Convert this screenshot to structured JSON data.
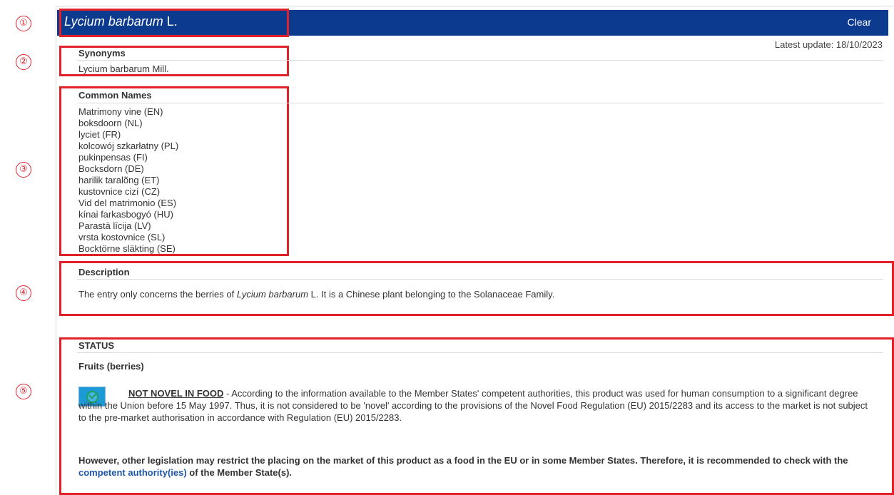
{
  "header": {
    "title_species": "Lycium barbarum",
    "title_author": "L.",
    "clear_label": "Clear"
  },
  "latest_update": "Latest update: 18/10/2023",
  "markers": [
    "①",
    "②",
    "③",
    "④",
    "⑤"
  ],
  "synonyms": {
    "heading": "Synonyms",
    "value": "Lycium barbarum Mill."
  },
  "common_names": {
    "heading": "Common Names",
    "items": [
      "Matrimony vine (EN)",
      "boksdoorn (NL)",
      "lyciet (FR)",
      "kolcowój szkarłatny (PL)",
      "pukinpensas (FI)",
      "Bocksdorn (DE)",
      "harilik taralõng (ET)",
      "kustovnice cizí (CZ)",
      "Vid del matrimonio (ES)",
      "kínai farkasbogyó (HU)",
      "Parastā līcija (LV)",
      "vrsta kostovnice (SL)",
      "Bocktörne släkting (SE)"
    ]
  },
  "description": {
    "heading": "Description",
    "text_before": "The entry only concerns the berries of ",
    "text_italic": "Lycium barbarum",
    "text_after": " L. It is a Chinese plant belonging to the Solanaceae Family."
  },
  "status": {
    "heading": "STATUS",
    "subheading": "Fruits (berries)",
    "icon": "check-circle-icon",
    "label": "NOT NOVEL IN FOOD",
    "text": " - According to the information available to the Member States' competent authorities, this product was used for human consumption to a significant degree within the Union before 15 May 1997. Thus, it is not considered to be 'novel' according to the provisions of the Novel Food Regulation (EU) 2015/2283 and its access to the market is not subject to the pre-market authorisation in accordance with Regulation (EU) 2015/2283.",
    "warning_before": "However, other legislation may restrict the placing on the market of this product as a food in the EU or in some Member States. Therefore, it is recommended to check with the ",
    "warning_link": "competent authority(ies)",
    "warning_after": " of the Member State(s)."
  },
  "colors": {
    "header_bg": "#0b3a8e",
    "annotation_red": "#e0212a",
    "link_blue": "#1f57a8"
  }
}
